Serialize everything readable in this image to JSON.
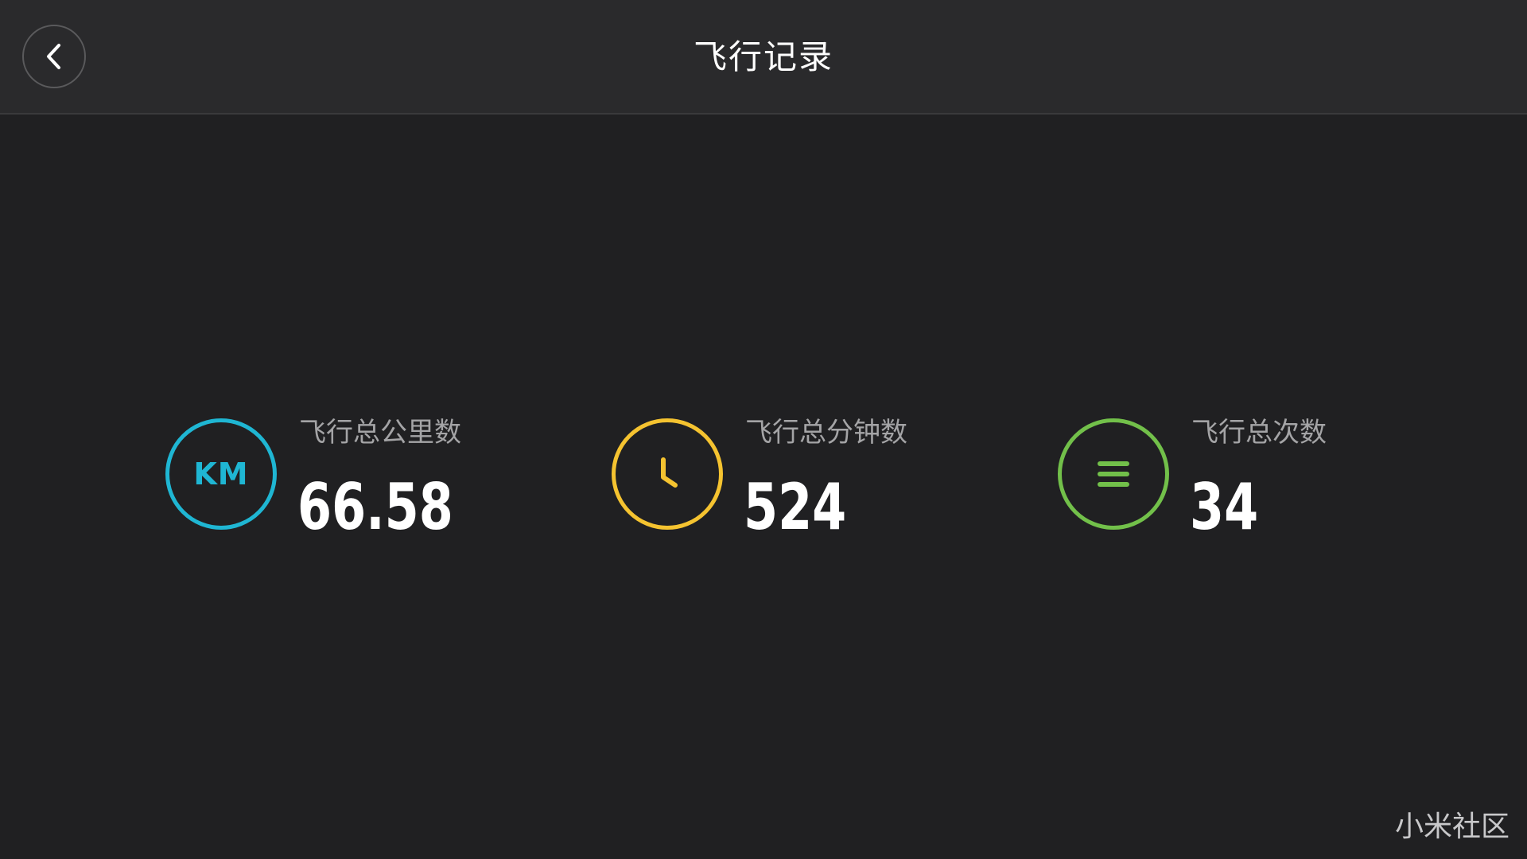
{
  "header": {
    "title": "飞行记录",
    "back_icon": "chevron-left-icon"
  },
  "stats": [
    {
      "icon": "km-icon",
      "icon_text": "KM",
      "color": "#1fb6d3",
      "label": "飞行总公里数",
      "value": "66.58"
    },
    {
      "icon": "clock-icon",
      "color": "#f5c330",
      "label": "飞行总分钟数",
      "value": "524"
    },
    {
      "icon": "list-icon",
      "color": "#72c04a",
      "label": "飞行总次数",
      "value": "34"
    }
  ],
  "watermark": "小米社区"
}
